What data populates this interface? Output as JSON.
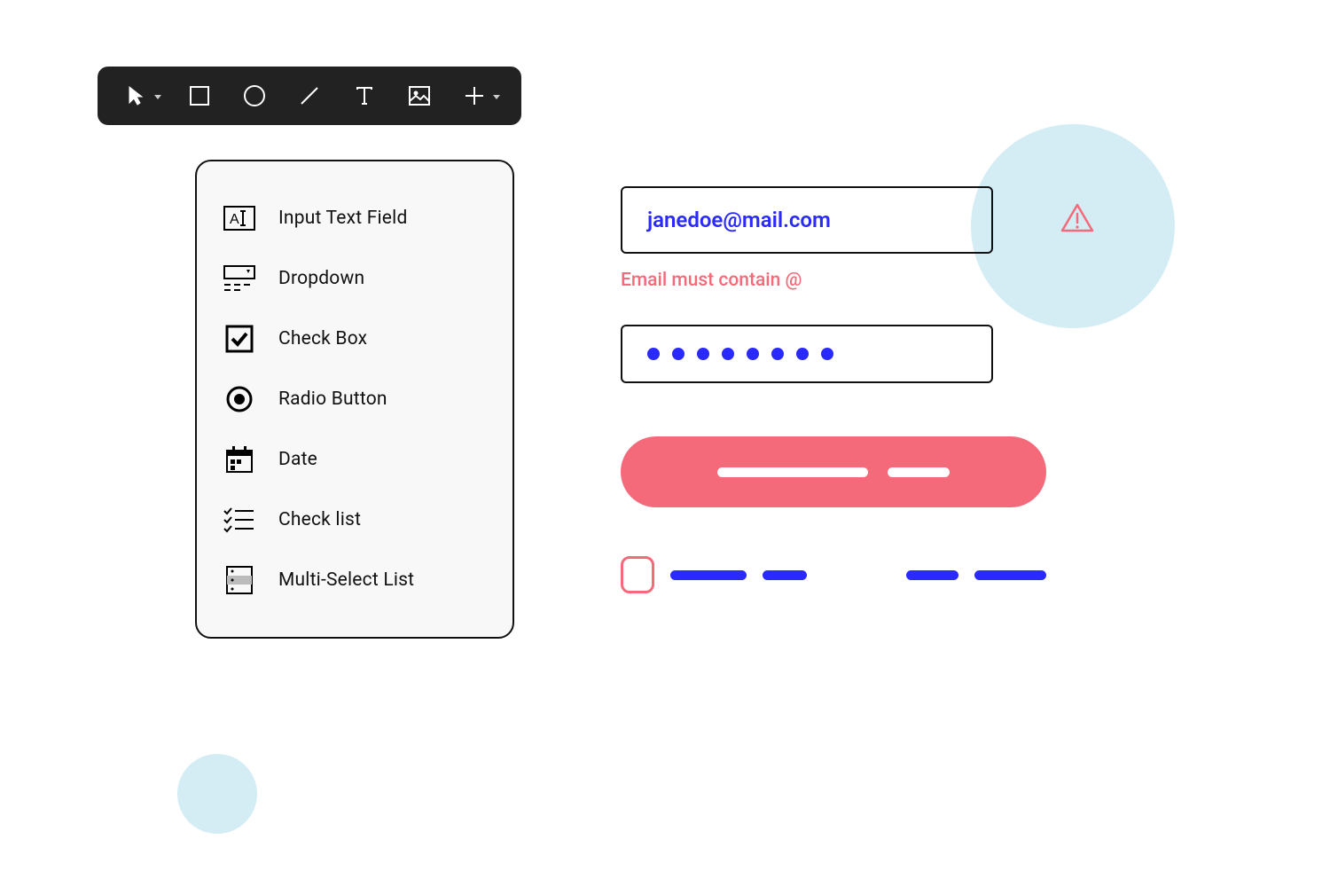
{
  "toolbar": {
    "tools": [
      "cursor",
      "rectangle",
      "circle",
      "line",
      "text",
      "image",
      "add"
    ]
  },
  "panel": {
    "items": [
      {
        "id": "input-text",
        "label": "Input Text Field"
      },
      {
        "id": "dropdown",
        "label": "Dropdown"
      },
      {
        "id": "checkbox",
        "label": "Check Box"
      },
      {
        "id": "radio",
        "label": "Radio Button"
      },
      {
        "id": "date",
        "label": "Date"
      },
      {
        "id": "checklist",
        "label": "Check list"
      },
      {
        "id": "multiselect",
        "label": "Multi-Select List"
      }
    ]
  },
  "form": {
    "email_value": "janedoe@mail.com",
    "email_error": "Email must contain @",
    "password_dot_count": 8,
    "colors": {
      "accent_blue": "#2a2aff",
      "error_pink": "#f56a7a"
    }
  }
}
